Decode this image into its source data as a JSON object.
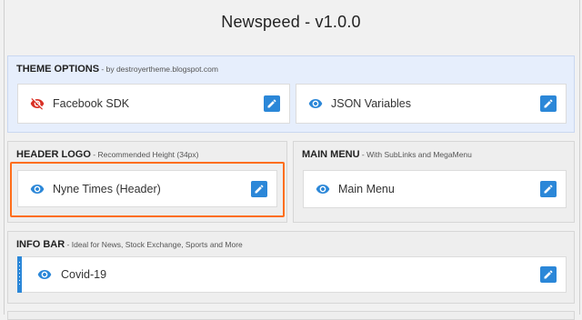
{
  "page": {
    "title": "Newspeed - v1.0.0"
  },
  "sections": {
    "theme_options": {
      "heading": "THEME OPTIONS",
      "subheading": " - by destroyertheme.blogspot.com",
      "widgets": [
        {
          "label": "Facebook SDK",
          "icon": "eye-off-icon",
          "visible": false
        },
        {
          "label": "JSON Variables",
          "icon": "eye-icon",
          "visible": true
        }
      ]
    },
    "header_logo": {
      "heading": "HEADER LOGO",
      "subheading": " - Recommended Height (34px)",
      "widgets": [
        {
          "label": "Nyne Times (Header)",
          "icon": "eye-icon",
          "visible": true,
          "highlighted": true
        }
      ]
    },
    "main_menu": {
      "heading": "MAIN MENU",
      "subheading": " - With SubLinks and MegaMenu",
      "widgets": [
        {
          "label": "Main Menu",
          "icon": "eye-icon",
          "visible": true
        }
      ]
    },
    "info_bar": {
      "heading": "INFO BAR",
      "subheading": " - Ideal for News, Stock Exchange, Sports and More",
      "widgets": [
        {
          "label": "Covid-19",
          "icon": "eye-icon",
          "visible": true,
          "draggable": true
        }
      ]
    }
  },
  "colors": {
    "accent": "#2b87d8",
    "eye_off": "#d93025",
    "highlight": "#ff6e1a",
    "theme_options_bg": "#e6eefc"
  }
}
